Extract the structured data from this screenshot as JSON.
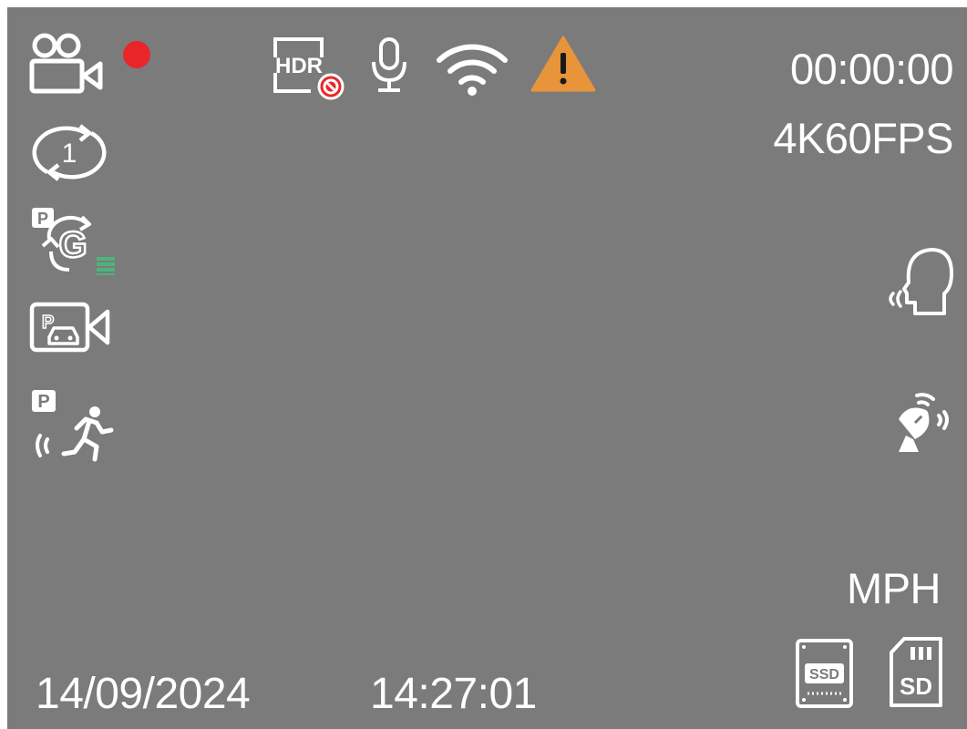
{
  "status": {
    "recording_indicator_color": "#e8262a",
    "warning_color": "#e8943a",
    "parking_level_color": "#4fb37a"
  },
  "top_bar": {
    "hdr_label": "HDR",
    "record_time": "00:00:00",
    "resolution": "4K60FPS",
    "icons": [
      "video-camera-icon",
      "recording-dot-icon",
      "hdr-off-icon",
      "microphone-icon",
      "wifi-icon",
      "warning-icon"
    ]
  },
  "left_column": {
    "loop_value": "1",
    "parking_gsensor_badge": "P",
    "gsensor_letter": "G",
    "parking_motion_badge": "P",
    "icons": [
      "loop-recording-icon",
      "parking-gsensor-icon",
      "parking-mode-camera-icon",
      "parking-motion-detection-icon"
    ]
  },
  "right_column": {
    "icons": [
      "voice-control-icon",
      "gps-satellite-icon"
    ],
    "speed_unit": "MPH",
    "ssd_label": "SSD",
    "sd_label": "SD"
  },
  "bottom_bar": {
    "date": "14/09/2024",
    "time": "14:27:01"
  }
}
